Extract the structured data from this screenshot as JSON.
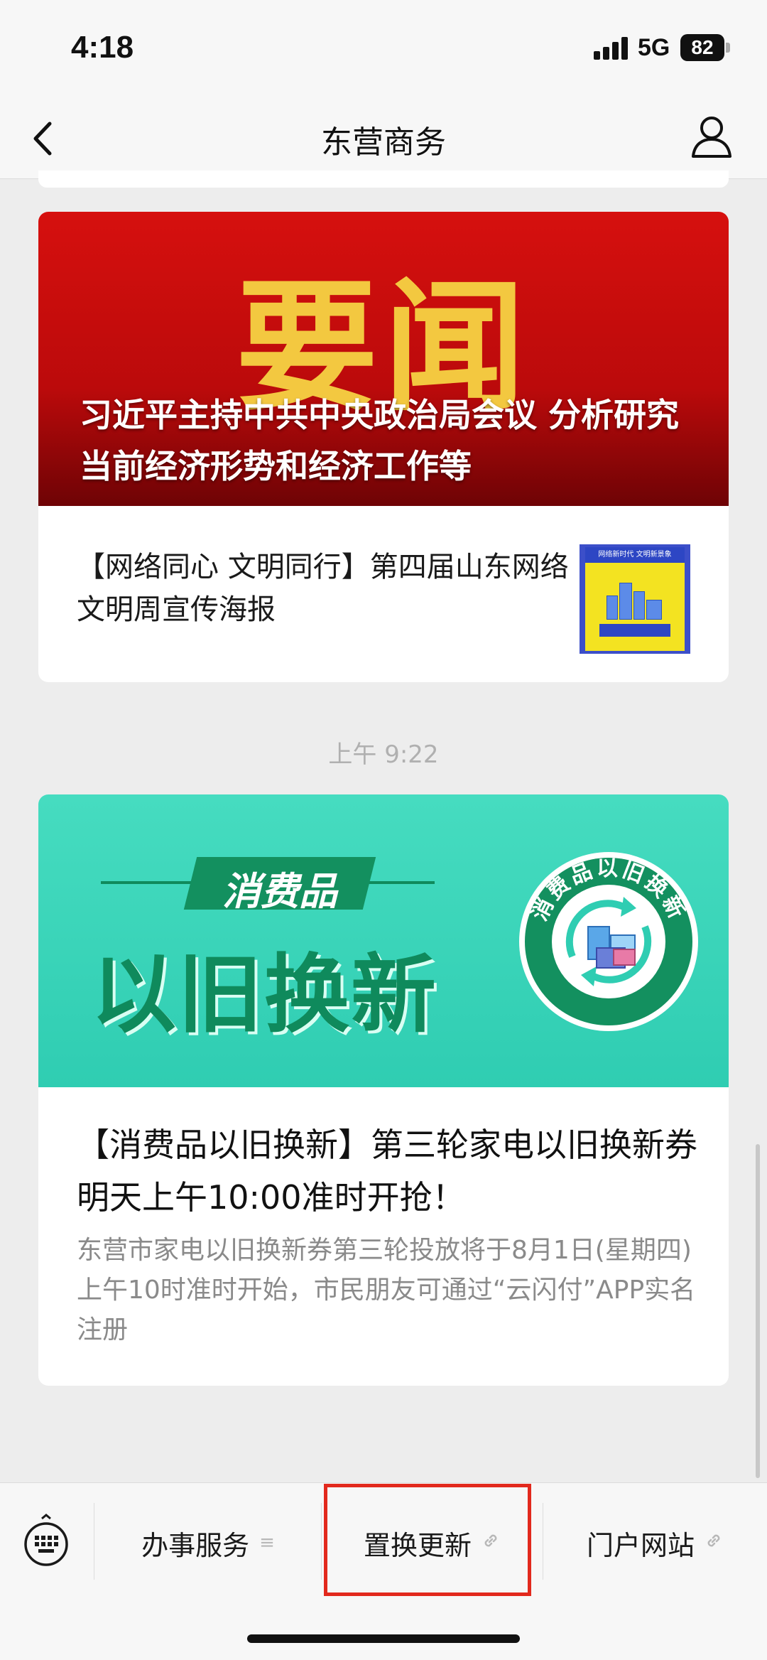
{
  "status_bar": {
    "time": "4:18",
    "network": "5G",
    "battery": "82"
  },
  "header": {
    "title": "东营商务"
  },
  "article1": {
    "banner_headline": "要闻",
    "banner_title": "习近平主持中共中央政治局会议 分析研究当前经济形势和经济工作等",
    "sub_title": "【网络同心 文明同行】第四届山东网络文明周宣传海报",
    "thumb_band": "网络新时代 文明新景象"
  },
  "timestamp": "上午 9:22",
  "article2": {
    "banner_tag": "消费品",
    "banner_main": "以旧换新",
    "badge_text": "消费品以旧换新",
    "title": "【消费品以旧换新】第三轮家电以旧换新券明天上午10:00准时开抢！",
    "description": "东营市家电以旧换新券第三轮投放将于8月1日(星期四) 上午10时准时开始，市民朋友可通过“云闪付”APP实名注册"
  },
  "bottom_menu": {
    "items": [
      {
        "label": "办事服务",
        "icon": "list-icon"
      },
      {
        "label": "置换更新",
        "icon": "link-icon"
      },
      {
        "label": "门户网站",
        "icon": "link-icon"
      }
    ],
    "highlight_color": "#e2291d"
  }
}
